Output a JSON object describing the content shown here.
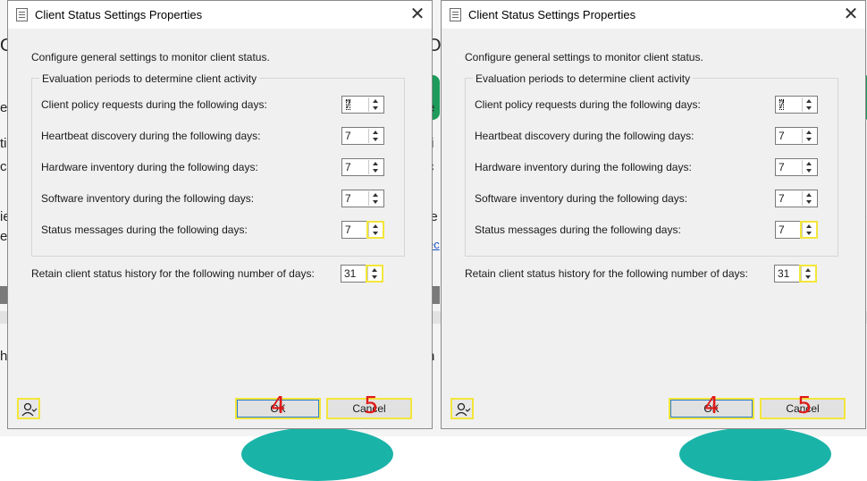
{
  "dialog": {
    "title": "Client Status Settings Properties",
    "close_symbol": "✕",
    "intro": "Configure general settings to monitor client status.",
    "group_title": "Evaluation periods to determine client activity",
    "rows": [
      {
        "label": "Client policy requests during the following days:",
        "value": "7"
      },
      {
        "label": "Heartbeat discovery during the following days:",
        "value": "7"
      },
      {
        "label": "Hardware inventory during the following days:",
        "value": "7"
      },
      {
        "label": "Software inventory during the following days:",
        "value": "7"
      },
      {
        "label": "Status messages during the following days:",
        "value": "7"
      }
    ],
    "retain_label": "Retain client status history for the following number of days:",
    "retain_value": "31",
    "ok_label": "OK",
    "cancel_label": "Cancel",
    "marker_ok": "4",
    "marker_cancel": "5"
  },
  "background": {
    "fragments": [
      "O",
      "e",
      "ti",
      "c",
      "ie",
      "ec",
      "w",
      "h",
      "n"
    ]
  },
  "colors": {
    "highlight": "#f3e63a",
    "marker": "#e01818",
    "dialog_bg": "#f0f0f0",
    "background_green": "#1e9a5a",
    "background_teal": "#1ab3a8"
  },
  "icons": [
    "title-dialog-icon",
    "close-icon",
    "spin-up-icon",
    "spin-down-icon",
    "help-user-icon"
  ]
}
